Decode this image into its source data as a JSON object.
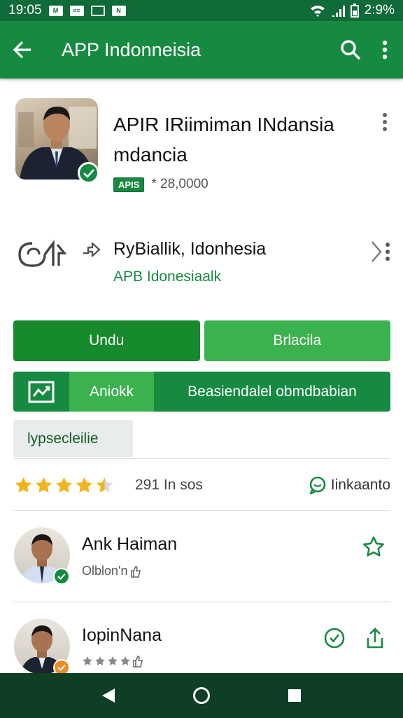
{
  "status_bar": {
    "time": "19:05",
    "battery": "2:9%",
    "notif_1": "M",
    "notif_2": "≡≡",
    "notif_3": "N"
  },
  "app_bar": {
    "title": "APP Indonneisia"
  },
  "app": {
    "title": "APIR IRiimiman INdansia mdancia",
    "badge": "APIS",
    "rating_text": "* 28,0000"
  },
  "developer": {
    "name": "RyBiallik, Idonhesia",
    "subtitle": "APB Idonesiaalk"
  },
  "buttons": {
    "primary": "Undu",
    "secondary": "Brlacila"
  },
  "tabs": {
    "first": "Aniokk",
    "second": "Beasiendalel obmdbabian"
  },
  "chip": {
    "label": "lypsecleilie"
  },
  "rating": {
    "stars": 4.5,
    "count": "291 In sos",
    "link": "Iinkaanto"
  },
  "reviews": [
    {
      "name": "Ank Haiman",
      "sub": "Olblon'n"
    },
    {
      "name": "IopinNana",
      "sub": ""
    }
  ],
  "colors": {
    "primary": "#178a42",
    "dark": "#0f6b37",
    "star": "#f2b41c",
    "nav": "#0e3e23"
  }
}
